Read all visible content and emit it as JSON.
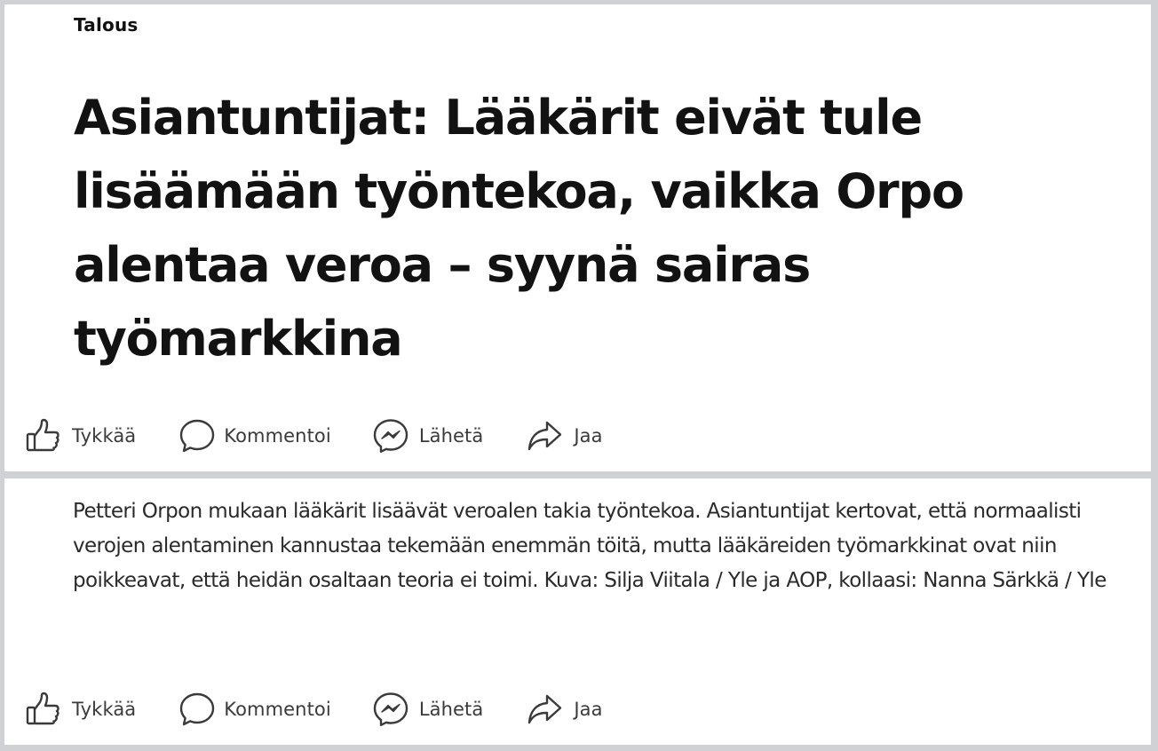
{
  "post": {
    "category": "Talous",
    "headline": "Asiantuntijat: Lääkärit eivät tule lisäämään työntekoa, vaikka Orpo alentaa veroa – syynä sairas työmarkkina",
    "caption": "Petteri Orpon mukaan lääkärit lisäävät veroalen takia työntekoa. Asiantuntijat kertovat, että normaalisti verojen alentaminen kannustaa tekemään enemmän töitä, mutta lääkäreiden työmarkkinat ovat niin poikkeavat, että heidän osaltaan teoria ei toimi. Kuva: Silja Viitala / Yle ja AOP, kollaasi: Nanna Särkkä / Yle"
  },
  "actions": {
    "like": "Tykkää",
    "comment": "Kommentoi",
    "send": "Lähetä",
    "share": "Jaa"
  },
  "icons": {
    "like": "thumbs-up-icon",
    "comment": "comment-bubble-icon",
    "send": "messenger-icon",
    "share": "share-arrow-icon"
  },
  "colors": {
    "background": "#cfd1d4",
    "panel": "#ffffff",
    "text": "#121212",
    "action_text": "#3a3a3a"
  }
}
